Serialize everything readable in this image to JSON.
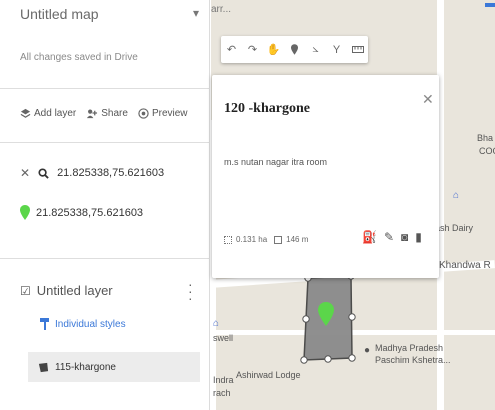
{
  "panel": {
    "map_title": "Untitled map",
    "save_status": "All changes saved in Drive",
    "actions": [
      {
        "icon": "add-layer-icon",
        "label": "Add layer"
      },
      {
        "icon": "share-icon",
        "label": "Share"
      },
      {
        "icon": "preview-icon",
        "label": "Preview"
      }
    ],
    "search": {
      "value": "21.825338,75.621603"
    },
    "result": {
      "label": "21.825338,75.621603"
    },
    "layer": {
      "name": "Untitled layer",
      "checked": true,
      "styles_label": "Individual styles",
      "feature_label": "115-khargone"
    }
  },
  "map": {
    "top_tabs": "arr...",
    "labels": {
      "bha": "Bha",
      "coc": "COC",
      "dairy": "ash Dairy",
      "khandwa": "Khandwa R",
      "swell": "swell",
      "indra": "Indra",
      "rach": "rach",
      "ashirwad": "Ashirwad Lodge",
      "madhya1": "Madhya Pradesh",
      "madhya2": "Paschim Kshetra..."
    }
  },
  "popup": {
    "title": "120 -khargone",
    "description": "m.s nutan nagar itra room",
    "area": "0.131 ha",
    "perimeter": "146 m"
  },
  "colors": {
    "accent": "#3b78d8",
    "polygon_fill": "#8a8a8a",
    "marker": "#5bd64a",
    "map_bg": "#e9e5dc"
  }
}
